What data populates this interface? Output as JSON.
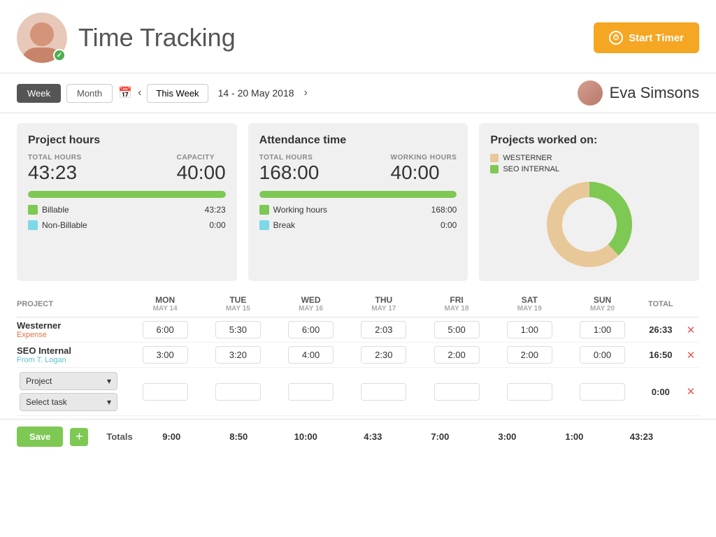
{
  "header": {
    "title": "Time Tracking",
    "start_timer_label": "Start Timer"
  },
  "nav": {
    "tab_week": "Week",
    "tab_month": "Month",
    "this_week_label": "This Week",
    "date_range": "14 - 20 May 2018",
    "user_name": "Eva Simsons"
  },
  "project_hours_card": {
    "title": "Project hours",
    "total_label": "TOTAL HOURS",
    "capacity_label": "CAPACITY",
    "total_value": "43:23",
    "capacity_value": "40:00",
    "progress_pct": 100,
    "billable_label": "Billable",
    "billable_value": "43:23",
    "nonbillable_label": "Non-Billable",
    "nonbillable_value": "0:00"
  },
  "attendance_card": {
    "title": "Attendance time",
    "total_label": "TOTAL HOURS",
    "working_label": "WORKING HOURS",
    "total_value": "168:00",
    "working_value": "40:00",
    "progress_pct": 100,
    "working_hours_label": "Working hours",
    "working_hours_value": "168:00",
    "break_label": "Break",
    "break_value": "0:00"
  },
  "projects_worked_card": {
    "title": "Projects worked on:",
    "legend": [
      {
        "label": "WESTERNER",
        "color": "#e8c898"
      },
      {
        "label": "SEO INTERNAL",
        "color": "#7ec854"
      }
    ],
    "donut": {
      "westerner_pct": 62,
      "seo_pct": 38
    }
  },
  "table": {
    "headers": {
      "project": "PROJECT",
      "mon": "Mon",
      "mon_date": "May 14",
      "tue": "Tue",
      "tue_date": "May 15",
      "wed": "Wed",
      "wed_date": "May 16",
      "thu": "Thu",
      "thu_date": "May 17",
      "fri": "Fri",
      "fri_date": "May 18",
      "sat": "Sat",
      "sat_date": "May 19",
      "sun": "Sun",
      "sun_date": "May 20",
      "total": "TOTAL"
    },
    "rows": [
      {
        "project": "Westerner",
        "sub": "Expense",
        "sub_color": "orange",
        "mon": "6:00",
        "tue": "5:30",
        "wed": "6:00",
        "thu": "2:03",
        "fri": "5:00",
        "sat": "1:00",
        "sun": "1:00",
        "total": "26:33"
      },
      {
        "project": "SEO Internal",
        "sub": "From T. Logan",
        "sub_color": "blue",
        "mon": "3:00",
        "tue": "3:20",
        "wed": "4:00",
        "thu": "2:30",
        "fri": "2:00",
        "sat": "2:00",
        "sun": "0:00",
        "total": "16:50"
      }
    ],
    "new_row": {
      "project_label": "Project",
      "task_label": "Select task",
      "total": "0:00"
    },
    "totals": {
      "label": "Totals",
      "mon": "9:00",
      "tue": "8:50",
      "wed": "10:00",
      "thu": "4:33",
      "fri": "7:00",
      "sat": "3:00",
      "sun": "1:00",
      "total": "43:23"
    }
  },
  "footer": {
    "save_label": "Save",
    "add_label": "+"
  }
}
